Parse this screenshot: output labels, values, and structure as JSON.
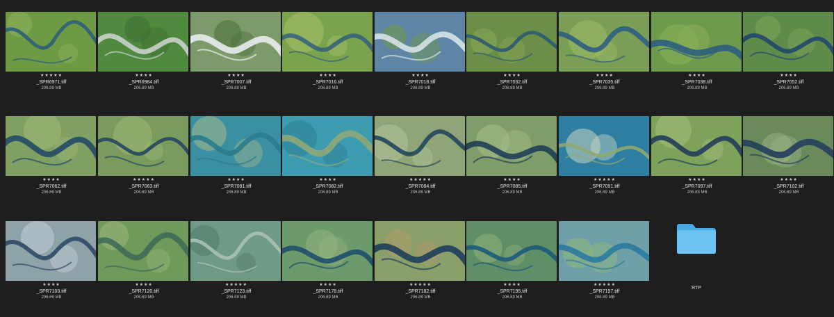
{
  "colors": {
    "background": "#1e1e1e",
    "folder": "#5ab8ee"
  },
  "items": [
    {
      "name": "_SPR6971.tiff",
      "size": "206.89 MB",
      "rating": "★★★★★"
    },
    {
      "name": "_SPR6984.tiff",
      "size": "206.89 MB",
      "rating": "★★★★"
    },
    {
      "name": "_SPR7007.tiff",
      "size": "206.89 MB",
      "rating": "★★★★"
    },
    {
      "name": "_SPR7016.tiff",
      "size": "206.89 MB",
      "rating": "★★★★"
    },
    {
      "name": "_SPR7018.tiff",
      "size": "206.89 MB",
      "rating": "★★★★"
    },
    {
      "name": "_SPR7032.tiff",
      "size": "206.89 MB",
      "rating": "★★★★"
    },
    {
      "name": "_SPR7035.tiff",
      "size": "206.89 MB",
      "rating": "★★★★"
    },
    {
      "name": "_SPR7038.tiff",
      "size": "206.89 MB",
      "rating": "★★★★"
    },
    {
      "name": "_SPR7052.tiff",
      "size": "206.89 MB",
      "rating": "★★★★"
    },
    {
      "name": "_SPR7062.tiff",
      "size": "206.89 MB",
      "rating": "★★★★"
    },
    {
      "name": "_SPR7063.tiff",
      "size": "206.89 MB",
      "rating": "★★★★★"
    },
    {
      "name": "_SPR7081.tiff",
      "size": "206.89 MB",
      "rating": "★★★★"
    },
    {
      "name": "_SPR7082.tiff",
      "size": "206.89 MB",
      "rating": "★★★★"
    },
    {
      "name": "_SPR7084.tiff",
      "size": "206.89 MB",
      "rating": "★★★★★"
    },
    {
      "name": "_SPR7085.tiff",
      "size": "206.89 MB",
      "rating": "★★★★"
    },
    {
      "name": "_SPR7091.tiff",
      "size": "206.89 MB",
      "rating": "★★★★★"
    },
    {
      "name": "_SPR7097.tiff",
      "size": "206.89 MB",
      "rating": "★★★★"
    },
    {
      "name": "_SPR7102.tiff",
      "size": "206.89 MB",
      "rating": "★★★★"
    },
    {
      "name": "_SPR7103.tiff",
      "size": "206.89 MB",
      "rating": "★★★★"
    },
    {
      "name": "_SPR7120.tiff",
      "size": "206.89 MB",
      "rating": "★★★★"
    },
    {
      "name": "_SPR7123.tiff",
      "size": "206.89 MB",
      "rating": "★★★★★"
    },
    {
      "name": "_SPR7178.tiff",
      "size": "206.89 MB",
      "rating": "★★★★"
    },
    {
      "name": "_SPR7182.tiff",
      "size": "206.89 MB",
      "rating": "★★★★★"
    },
    {
      "name": "_SPR7195.tiff",
      "size": "206.89 MB",
      "rating": "★★★★"
    },
    {
      "name": "_SPR7197.tiff",
      "size": "206.89 MB",
      "rating": "★★★★★"
    }
  ],
  "folder": {
    "name": "RTP",
    "icon": "folder-icon"
  }
}
